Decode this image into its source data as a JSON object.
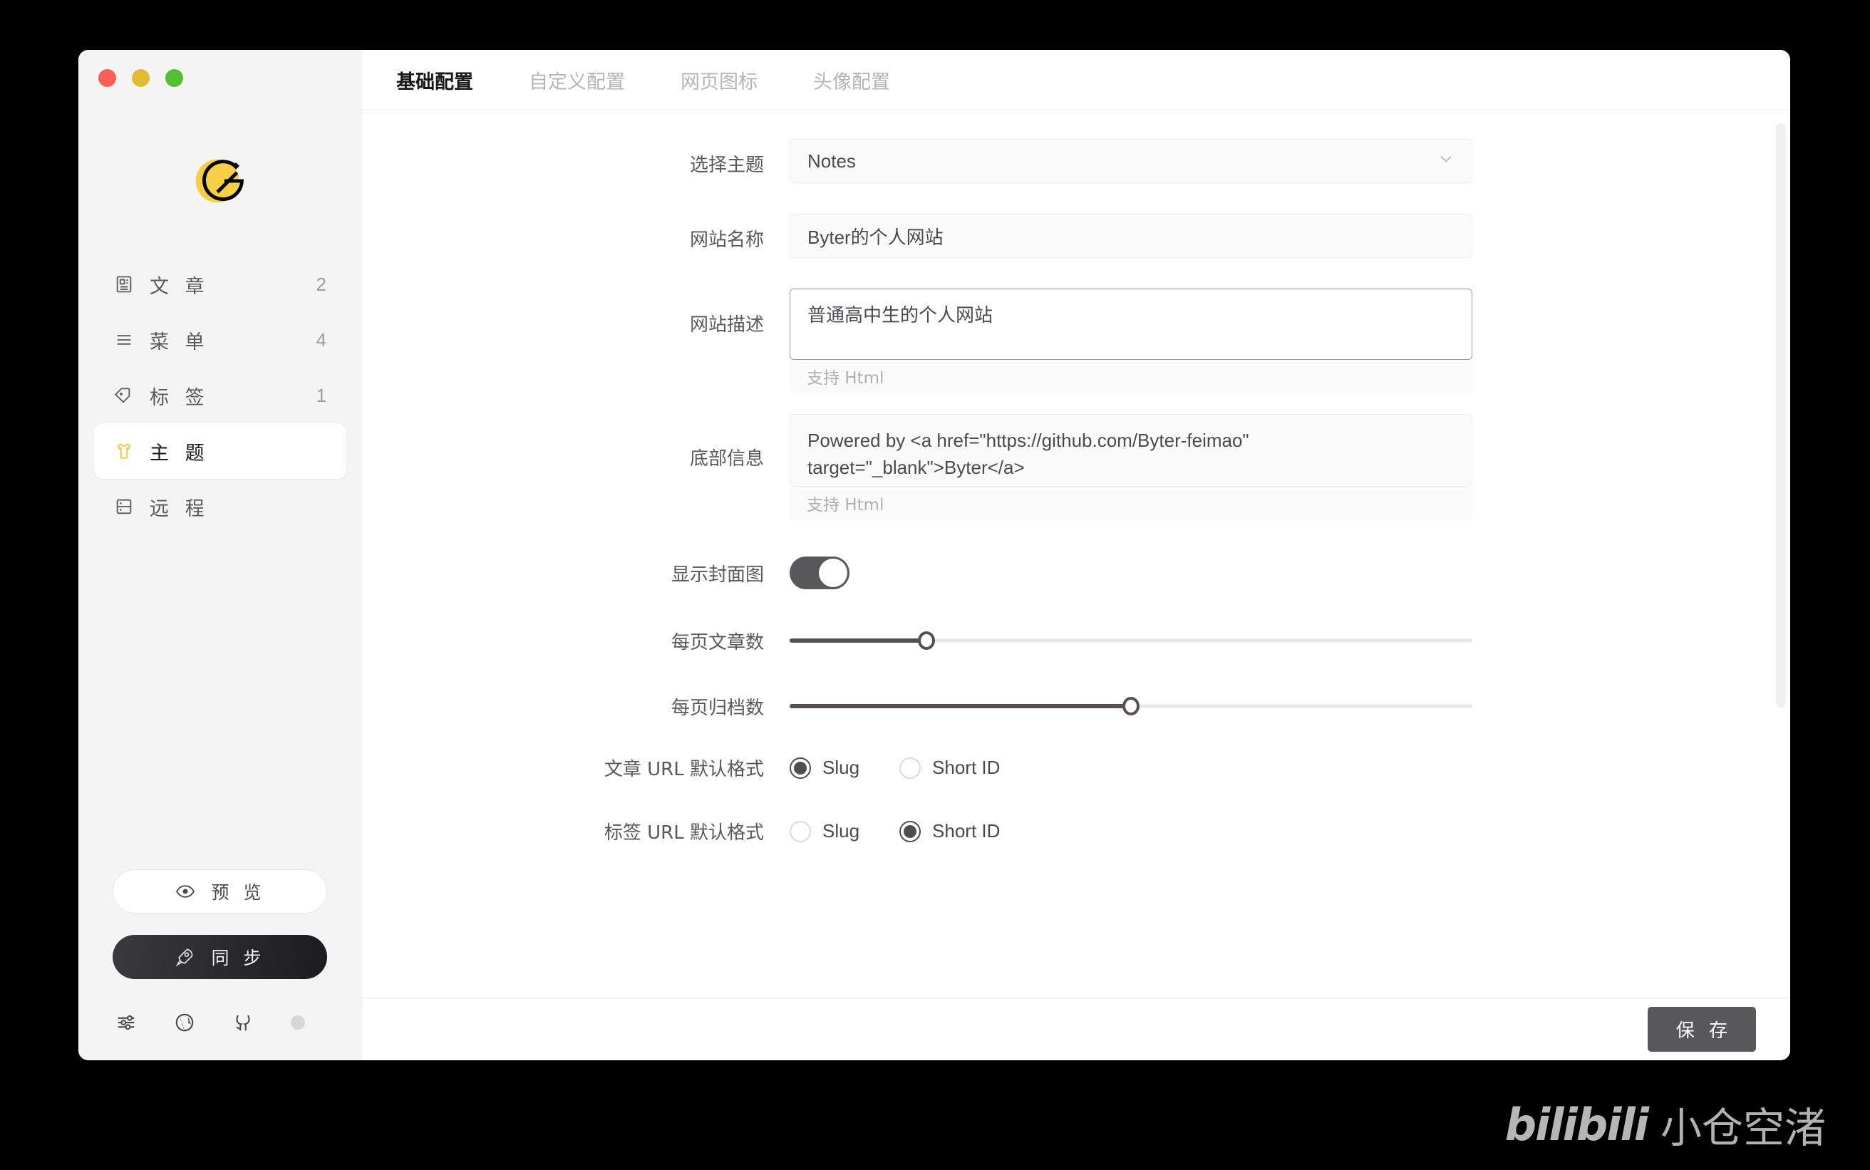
{
  "window": {
    "traffic_lights": [
      {
        "name": "close",
        "color": "#fd5f57"
      },
      {
        "name": "minimize",
        "color": "#e0bc33"
      },
      {
        "name": "maximize",
        "color": "#55bf32"
      }
    ],
    "logo_icon": "gridea-logo-icon"
  },
  "sidebar": {
    "items": [
      {
        "label": "文 章",
        "count": "2",
        "icon": "article-icon",
        "active": false
      },
      {
        "label": "菜 单",
        "count": "4",
        "icon": "menu-lines-icon",
        "active": false
      },
      {
        "label": "标 签",
        "count": "1",
        "icon": "tag-icon",
        "active": false
      },
      {
        "label": "主 题",
        "count": "",
        "icon": "tshirt-icon",
        "active": true
      },
      {
        "label": "远 程",
        "count": "",
        "icon": "server-icon",
        "active": false
      }
    ],
    "preview_button": {
      "label": "预 览",
      "icon": "eye-icon"
    },
    "sync_button": {
      "label": "同 步",
      "icon": "rocket-icon"
    },
    "foot_icons": [
      "sliders-icon",
      "globe-icon",
      "github-icon",
      "status-dot-icon"
    ]
  },
  "tabs": [
    {
      "label": "基础配置",
      "active": true
    },
    {
      "label": "自定义配置",
      "active": false
    },
    {
      "label": "网页图标",
      "active": false
    },
    {
      "label": "头像配置",
      "active": false
    }
  ],
  "form": {
    "theme": {
      "label": "选择主题",
      "value": "Notes",
      "chevron": "chevron-down-icon"
    },
    "site_name": {
      "label": "网站名称",
      "value": "Byter的个人网站"
    },
    "site_description": {
      "label": "网站描述",
      "value": "普通高中生的个人网站",
      "hint": "支持 Html"
    },
    "footer_info": {
      "label": "底部信息",
      "value": "Powered by <a href=\"https://github.com/Byter-feimao\" target=\"_blank\">Byter</a>",
      "hint": "支持 Html"
    },
    "show_cover": {
      "label": "显示封面图",
      "state": "on"
    },
    "posts_per_page": {
      "label": "每页文章数",
      "percent": 20
    },
    "archives_per_page": {
      "label": "每页归档数",
      "percent": 50
    },
    "post_url_format": {
      "label": "文章 URL 默认格式",
      "options": [
        {
          "label": "Slug",
          "checked": true
        },
        {
          "label": "Short ID",
          "checked": false
        }
      ]
    },
    "tag_url_format": {
      "label": "标签 URL 默认格式",
      "options": [
        {
          "label": "Slug",
          "checked": false
        },
        {
          "label": "Short ID",
          "checked": true
        }
      ]
    }
  },
  "footer": {
    "save_label": "保 存"
  },
  "watermark": {
    "logo": "bilibili",
    "text": "小仓空渚"
  },
  "colors": {
    "accent": "#f2c94c",
    "dark": "#18181a",
    "muted": "#9c9c9e"
  }
}
